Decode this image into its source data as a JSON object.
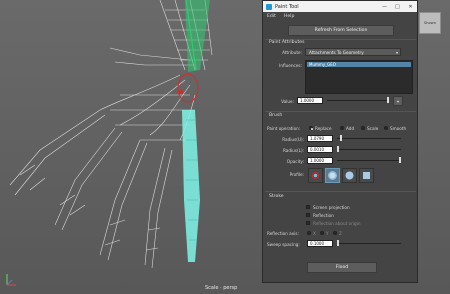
{
  "window": {
    "title": "Paint Tool",
    "controls": [
      "—",
      "□",
      "✕"
    ]
  },
  "menu": [
    "Edit",
    "Help"
  ],
  "refresh_button": "Refresh From Selection",
  "paint_attributes": {
    "section_title": "Paint Attributes",
    "attribute_label": "Attribute:",
    "attribute_value": "Attachments To Geometry",
    "influences_label": "Influences:",
    "influences": [
      "Mummy_GEO"
    ],
    "value_label": "Value:",
    "value": "1.0000",
    "value_slider": 1.0
  },
  "brush": {
    "section_title": "Brush",
    "operation_label": "Paint operation:",
    "operations": [
      "Replace",
      "Add",
      "Scale",
      "Smooth"
    ],
    "selected_operation": "Replace",
    "radius_u_label": "Radius(U):",
    "radius_u": "1.0790",
    "radius_u_slider": 0.05,
    "radius_l_label": "Radius(L):",
    "radius_l": "0.0010",
    "radius_l_slider": 0.0,
    "opacity_label": "Opacity:",
    "opacity": "1.0000",
    "opacity_slider": 1.0,
    "profile_label": "Profile:",
    "profiles": [
      "gaussian-icon",
      "soft-icon",
      "solid-circle-icon",
      "square-icon"
    ],
    "selected_profile": 1
  },
  "stroke": {
    "section_title": "Stroke",
    "screen_projection": "Screen projection",
    "reflection": "Reflection",
    "reflection_about_origin": "Reflection about origin",
    "reflection_axis_label": "Reflection axis:",
    "axes": [
      "X",
      "Y",
      "Z"
    ],
    "sweep_spacing_label": "Sweep spacing:",
    "sweep_spacing": "0.1000",
    "sweep_slider": 0.0
  },
  "flood_button": "Flood",
  "viewport": {
    "camera_label": "Scale · persp",
    "side_button": "Shown"
  },
  "colors": {
    "panel": "#444444",
    "viewport_bg": "#626262",
    "wire": "#e8e8e8",
    "selection_green": "#2ecc71",
    "weight_cyan": "#7ff5e6",
    "highlight_red": "#d22b2b",
    "list_selection": "#5285a6"
  }
}
